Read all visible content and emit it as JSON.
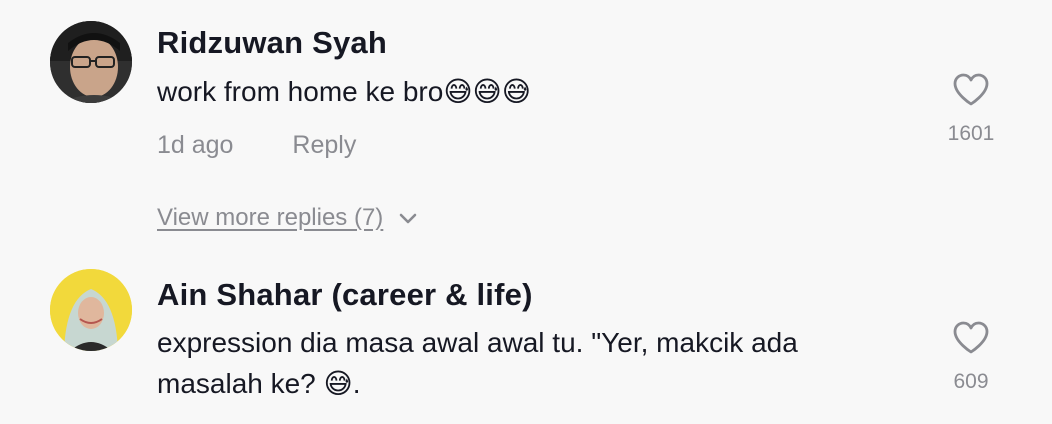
{
  "comments": [
    {
      "username": "Ridzuwan Syah",
      "text": "work from home ke bro",
      "emoji": "😅😅😅",
      "time": "1d ago",
      "reply_label": "Reply",
      "likes": "1601",
      "view_more": "View more replies (7)"
    },
    {
      "username": "Ain Shahar (career & life)",
      "text_line1": "expression dia masa awal awal tu. \"Yer, makcik ada",
      "text_line2": "masalah ke?",
      "emoji": "😅",
      "text_end": ".",
      "likes": "609"
    }
  ],
  "icons": {
    "like": "heart-outline-icon",
    "expand": "chevron-down-icon"
  }
}
